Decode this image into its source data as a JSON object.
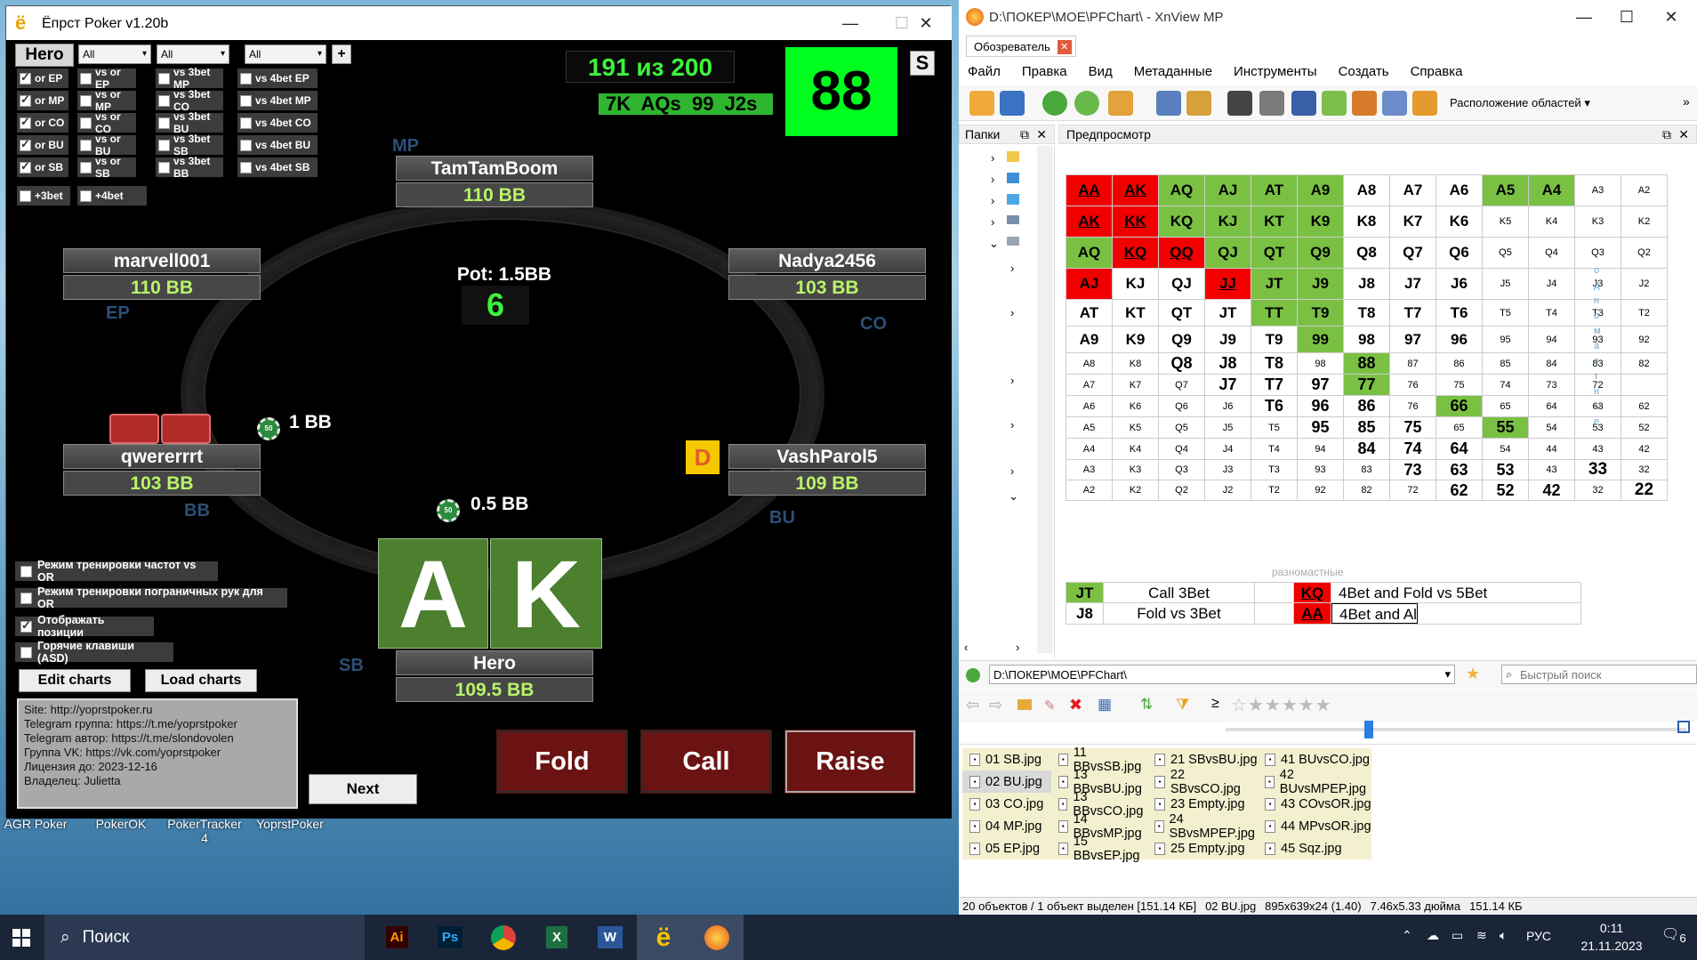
{
  "poker": {
    "title": "Ёпрст Poker v1.20b",
    "hero_btn": "Hero",
    "filters": [
      "All",
      "All",
      "All"
    ],
    "plus": "+",
    "col1": [
      "or EP",
      "or MP",
      "or CO",
      "or BU",
      "or SB"
    ],
    "col2": [
      "vs or EP",
      "vs or MP",
      "vs or CO",
      "vs or BU",
      "vs or SB"
    ],
    "col3": [
      "vs 3bet MP",
      "vs 3bet CO",
      "vs 3bet BU",
      "vs 3bet SB",
      "vs 3bet BB"
    ],
    "col4": [
      "vs 4bet EP",
      "vs 4bet MP",
      "vs 4bet CO",
      "vs 4bet BU",
      "vs 4bet SB"
    ],
    "extra": [
      "+3bet",
      "+4bet"
    ],
    "counter": "191 из 200",
    "history": "7K  AQs  99  J2s",
    "hand_big": "88",
    "s_label": "S",
    "pot": "Pot: 1.5BB",
    "pot_num": "6",
    "players": {
      "mp": {
        "name": "TamTamBoom",
        "stack": "110 BB",
        "pos": "MP"
      },
      "ep": {
        "name": "marvell001",
        "stack": "110 BB",
        "pos": "EP"
      },
      "co": {
        "name": "Nadya2456",
        "stack": "103 BB",
        "pos": "CO"
      },
      "bb": {
        "name": "qwererrrt",
        "stack": "103 BB",
        "pos": "BB"
      },
      "bu": {
        "name": "VashParol5",
        "stack": "109 BB",
        "pos": "BU"
      },
      "sb": {
        "name": "Hero",
        "stack": "109.5 BB",
        "pos": "SB"
      }
    },
    "bb_bet": "1 BB",
    "sb_bet": "0.5 BB",
    "chip": "50",
    "dealer": "D",
    "cards": [
      "A",
      "K"
    ],
    "options": [
      "Режим тренировки частот vs OR",
      "Режим тренировки пограничных рук для OR",
      "Отображать позиции",
      "Горячие клавиши (ASD)"
    ],
    "edit_charts": "Edit charts",
    "load_charts": "Load charts",
    "info": [
      "Site: http://yoprstpoker.ru",
      "Telegram группа: https://t.me/yoprstpoker",
      "Telegram автор: https://t.me/slondovolen",
      "Группа VK: https://vk.com/yoprstpoker",
      "Лицензия до: 2023-12-16",
      "Владелец: Julietta"
    ],
    "next": "Next",
    "fold": "Fold",
    "call": "Call",
    "raise": "Raise"
  },
  "xnview": {
    "title": "D:\\ПОКЕР\\МОЕ\\PFChart\\ - XnView MP",
    "tab": "Обозреватель",
    "menu": [
      "Файл",
      "Правка",
      "Вид",
      "Метаданные",
      "Инструменты",
      "Создать",
      "Справка"
    ],
    "layout": "Расположение областей",
    "folders": "Папки",
    "preview": "Предпросмотр",
    "side_label": "одномастные",
    "offsuit": "разномастные",
    "grid": [
      [
        "AA",
        "AK",
        "AQ",
        "AJ",
        "AT",
        "A9",
        "A8",
        "A7",
        "A6",
        "A5",
        "A4",
        "A3",
        "A2"
      ],
      [
        "AK",
        "KK",
        "KQ",
        "KJ",
        "KT",
        "K9",
        "K8",
        "K7",
        "K6",
        "K5",
        "K4",
        "K3",
        "K2"
      ],
      [
        "AQ",
        "KQ",
        "QQ",
        "QJ",
        "QT",
        "Q9",
        "Q8",
        "Q7",
        "Q6",
        "Q5",
        "Q4",
        "Q3",
        "Q2"
      ],
      [
        "AJ",
        "KJ",
        "QJ",
        "JJ",
        "JT",
        "J9",
        "J8",
        "J7",
        "J6",
        "J5",
        "J4",
        "J3",
        "J2"
      ],
      [
        "AT",
        "KT",
        "QT",
        "JT",
        "TT",
        "T9",
        "T8",
        "T7",
        "T6",
        "T5",
        "T4",
        "T3",
        "T2"
      ],
      [
        "A9",
        "K9",
        "Q9",
        "J9",
        "T9",
        "99",
        "98",
        "97",
        "96",
        "95",
        "94",
        "93",
        "92"
      ],
      [
        "A8",
        "K8",
        "Q8",
        "J8",
        "T8",
        "98",
        "88",
        "87",
        "86",
        "85",
        "84",
        "83",
        "82"
      ],
      [
        "A7",
        "K7",
        "Q7",
        "J7",
        "T7",
        "97",
        "77",
        "76",
        "75",
        "74",
        "73",
        "72",
        ""
      ],
      [
        "A6",
        "K6",
        "Q6",
        "J6",
        "T6",
        "96",
        "86",
        "76",
        "66",
        "65",
        "64",
        "63",
        "62"
      ],
      [
        "A5",
        "K5",
        "Q5",
        "J5",
        "T5",
        "95",
        "85",
        "75",
        "65",
        "55",
        "54",
        "53",
        "52"
      ],
      [
        "A4",
        "K4",
        "Q4",
        "J4",
        "T4",
        "94",
        "84",
        "74",
        "64",
        "54",
        "44",
        "43",
        "42"
      ],
      [
        "A3",
        "K3",
        "Q3",
        "J3",
        "T3",
        "93",
        "83",
        "73",
        "63",
        "53",
        "43",
        "33",
        "32"
      ],
      [
        "A2",
        "K2",
        "Q2",
        "J2",
        "T2",
        "92",
        "82",
        "72",
        "62",
        "52",
        "42",
        "32",
        "22"
      ]
    ],
    "legend": [
      {
        "k": "JT",
        "t": "Call 3Bet",
        "k2": "KQ",
        "t2": "4Bet and Fold vs 5Bet"
      },
      {
        "k": "J8",
        "t": "Fold vs 3Bet",
        "k2": "AA",
        "t2": "4Bet and Al"
      }
    ],
    "path": "D:\\ПОКЕР\\МОЕ\\PFChart\\",
    "quick_search": "Быстрый поиск",
    "files": [
      [
        "01 SB.jpg",
        "02 BU.jpg",
        "03 CO.jpg",
        "04 MP.jpg",
        "05 EP.jpg"
      ],
      [
        "11 BBvsSB.jpg",
        "13 BBvsBU.jpg",
        "13 BBvsCO.jpg",
        "14 BBvsMP.jpg",
        "15 BBvsEP.jpg"
      ],
      [
        "21 SBvsBU.jpg",
        "22 SBvsCO.jpg",
        "23 Empty.jpg",
        "24 SBvsMPEP.jpg",
        "25 Empty.jpg"
      ],
      [
        "41 BUvsCO.jpg",
        "42 BUvsMPEP.jpg",
        "43 COvsOR.jpg",
        "44 MPvsOR.jpg",
        "45 Sqz.jpg"
      ]
    ],
    "status": [
      "20 объектов / 1 объект выделен [151.14 КБ]",
      "02 BU.jpg",
      "895x639x24 (1.40)",
      "7.46x5.33 дюйма",
      "151.14 КБ"
    ]
  },
  "desktop": [
    "AGR Poker",
    "PokerOK",
    "PokerTracker 4",
    "YoprstPoker"
  ],
  "taskbar": {
    "search": "Поиск",
    "lang": "РУС",
    "time": "0:11",
    "date": "21.11.2023",
    "notif": "6"
  }
}
